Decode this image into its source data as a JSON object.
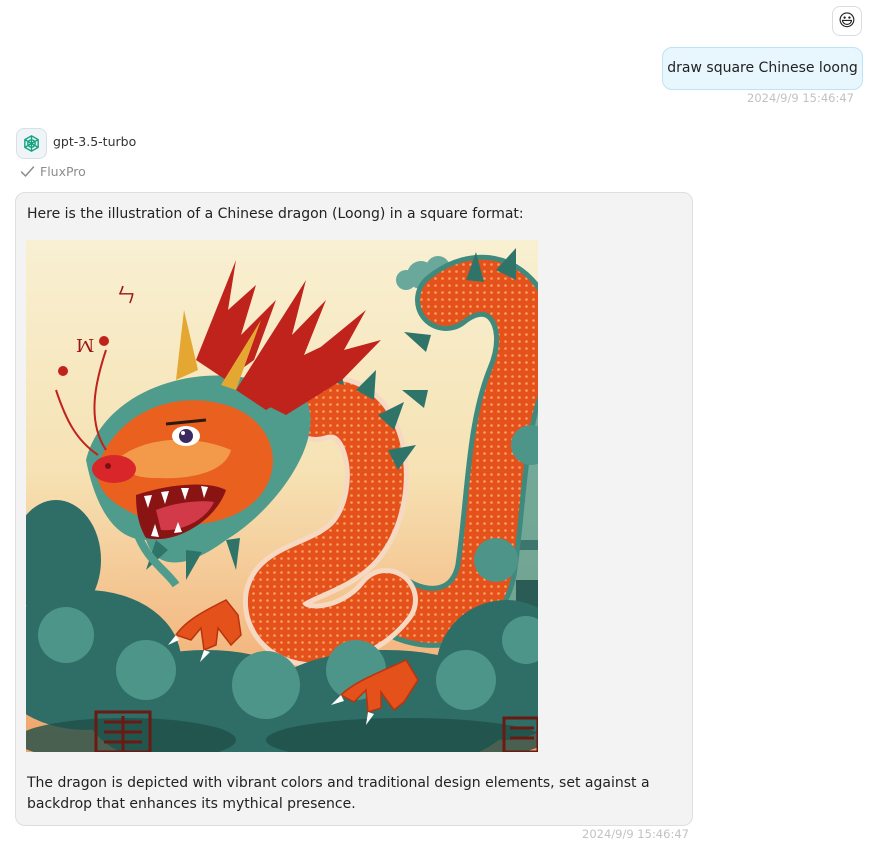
{
  "user_message": {
    "avatar_icon": "grinning-face-emoji",
    "avatar_glyph": "😃",
    "text": "draw square Chinese loong",
    "timestamp": "2024/9/9 15:46:47"
  },
  "assistant_message": {
    "avatar_icon": "openai-logo-icon",
    "model": "gpt-3.5-turbo",
    "tool": {
      "icon": "checkmark-icon",
      "name": "FluxPro"
    },
    "intro": "Here is the illustration of a Chinese dragon (Loong) in a square format:",
    "image": {
      "subject": "orange Chinese dragon with green mane and red antlers over teal clouds",
      "colors": {
        "sky_top": "#f7ecc9",
        "sky_bottom": "#f3b27a",
        "dragon_body": "#e8551f",
        "mane": "#4f9c8d",
        "antlers": "#c0221c",
        "clouds": "#2e6e66"
      }
    },
    "outro": "The dragon is depicted with vibrant colors and traditional design elements, set against a backdrop that enhances its mythical presence.",
    "timestamp": "2024/9/9 15:46:47"
  }
}
